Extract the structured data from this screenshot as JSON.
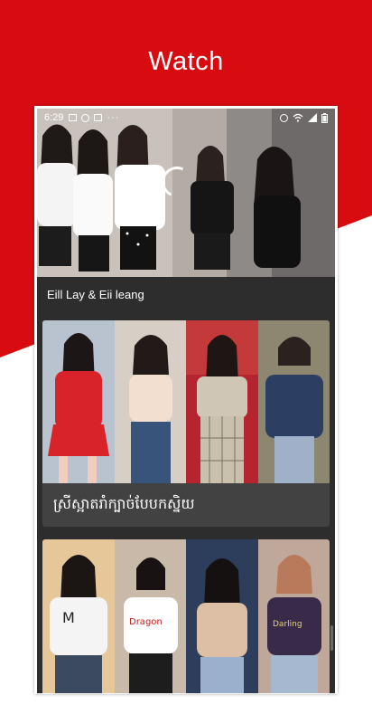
{
  "headline": "Watch",
  "status_bar": {
    "time": "6:29",
    "notification_icons": [
      "image-icon",
      "messenger-icon",
      "card-icon"
    ],
    "overflow": "···",
    "right_icons": [
      "alarm-icon",
      "wifi-icon",
      "signal-icon",
      "battery-icon"
    ]
  },
  "video": {
    "state": "loading"
  },
  "playlist": {
    "title": "Eill Lay & Eii leang",
    "cards": [
      {
        "title": "ស្រីស្អាតរាំក្បាច់បែបកស្និយ"
      },
      {
        "title": ""
      }
    ]
  },
  "colors": {
    "brand_red": "#d80c10",
    "sheet_bg": "#2d2d2d",
    "card_bg": "#424242"
  }
}
